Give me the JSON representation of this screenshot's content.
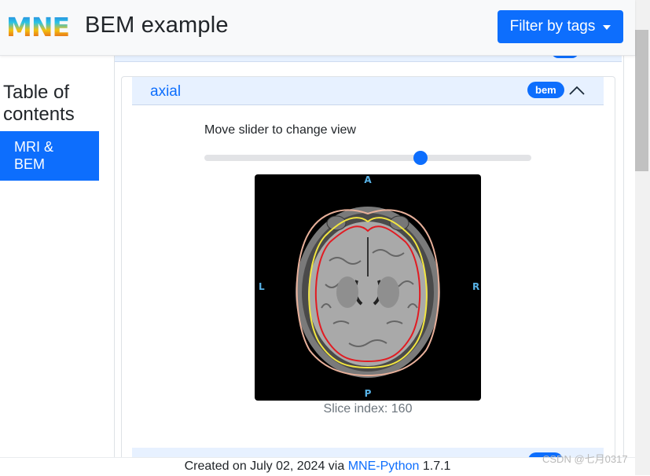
{
  "navbar": {
    "logo_text": "MNE",
    "title": "BEM example",
    "filter_button": "Filter by tags"
  },
  "sidebar": {
    "toc_title": "Table of contents",
    "items": [
      {
        "label": "MRI & BEM",
        "active": true
      }
    ]
  },
  "section": {
    "title": "axial",
    "badge": "bem",
    "expanded": true,
    "slider_label": "Move slider to change view",
    "slider_fraction": 0.66,
    "image": {
      "orientation_labels": {
        "top": "A",
        "bottom": "P",
        "left": "L",
        "right": "R"
      },
      "surfaces": [
        "outer skin",
        "outer skull",
        "inner skull"
      ],
      "colors": {
        "skin": "#e8b09a",
        "outer_skull": "#f2e640",
        "inner_skull": "#e11b22"
      }
    },
    "caption": "Slice index: 160"
  },
  "footer": {
    "prefix": "Created on July 02, 2024 via ",
    "link": "MNE-Python",
    "suffix": " 1.7.1"
  },
  "watermark": "CSDN @七月0317",
  "colors": {
    "primary": "#0d6efd",
    "accordion_bg": "#e7f1ff",
    "navbar_bg": "#f8f9fa"
  }
}
